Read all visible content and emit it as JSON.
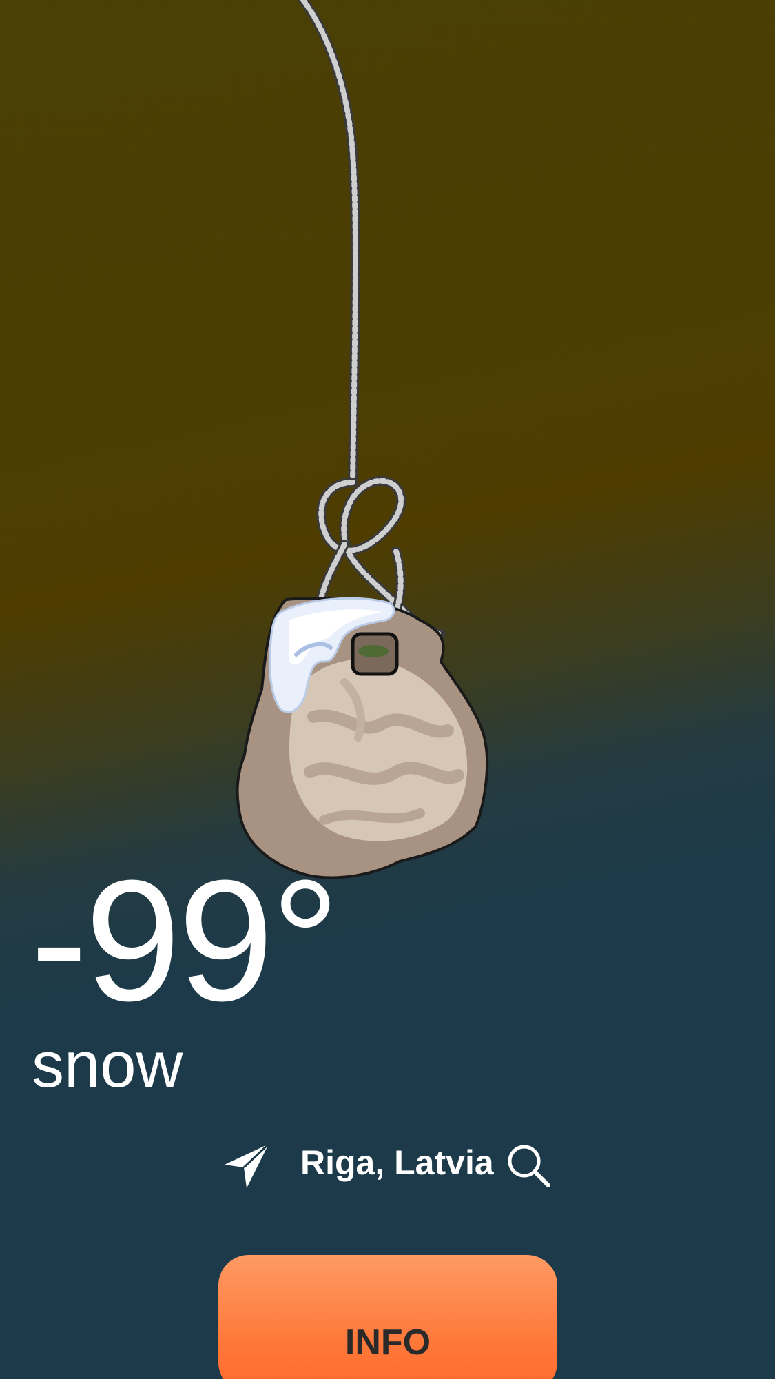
{
  "weather": {
    "temperature": "-99°",
    "condition": "snow"
  },
  "location": {
    "name": "Riga, Latvia",
    "locate_icon": "location-arrow-icon",
    "search_icon": "search-icon"
  },
  "actions": {
    "info_label": "INFO"
  },
  "illustration": {
    "subject": "stone-on-rope",
    "snow_cap": true
  },
  "colors": {
    "background_top": "#4a3f04",
    "background_bottom": "#1c3a4a",
    "button": "#ff7a3c",
    "button_text": "#2a2a2a",
    "text": "#ffffff"
  }
}
